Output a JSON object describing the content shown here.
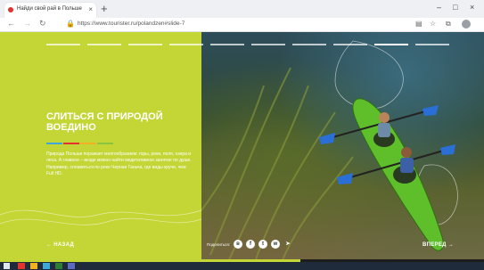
{
  "browser": {
    "tab_title": "Найди свой рай в Польше",
    "tab_close": "×",
    "new_tab": "+",
    "url": "https://www.tourister.ru/polandzen#slide-7",
    "nav_back": "←",
    "nav_forward": "→",
    "nav_reload": "↻",
    "lock": "🔒",
    "win_minimize": "–",
    "win_maximize": "□",
    "win_close": "×"
  },
  "slide": {
    "heading": "Слиться с природой воедино",
    "body": "Природа Польши поражает многообразием: горы, реки, поля, озера и леса. А главное – везде можно найти медитативное занятие по душе. Например, сплавиться по реке Черная Ганьча, где виды круче, чем Full HD.",
    "prev_label": "← НАЗАД",
    "next_label": "ВПЕРЕД →",
    "share_label": "Поделиться:",
    "progress_fraction": 0.62
  },
  "social": [
    {
      "icon": "vk-icon",
      "glyph": "в"
    },
    {
      "icon": "facebook-icon",
      "glyph": "f"
    },
    {
      "icon": "twitter-icon",
      "glyph": "t"
    },
    {
      "icon": "whatsapp-icon",
      "glyph": "w"
    },
    {
      "icon": "telegram-icon",
      "glyph": "➤"
    }
  ],
  "colors": {
    "accent": "#c3d636",
    "stripe_colors": [
      "#3fa6d8",
      "#e6322e",
      "#f2b120",
      "#8bc53f"
    ]
  }
}
